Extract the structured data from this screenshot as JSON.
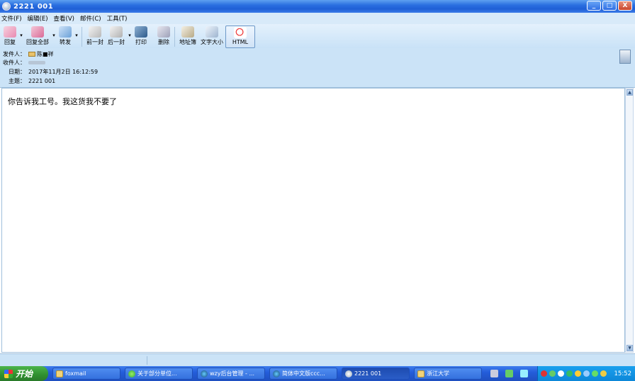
{
  "window": {
    "title": "2221 001",
    "buttons": {
      "minimize": "_",
      "maximize": "□",
      "close": "X"
    }
  },
  "menu": [
    "文件(F)",
    "编辑(E)",
    "查看(V)",
    "邮件(C)",
    "工具(T)"
  ],
  "toolbar": {
    "reply": "回复",
    "reply_all": "回复全部",
    "forward": "转发",
    "prev": "前一封",
    "next": "后一封",
    "print": "打印",
    "delete": "删除",
    "address_book": "地址簿",
    "font_size": "文字大小",
    "html": "HTML"
  },
  "header": {
    "from_label": "发件人：",
    "from_value": "陈■祥",
    "to_label": "收件人：",
    "date_label": "日期：",
    "date_value": "2017年11月2日 16:12:59",
    "subject_label": "主题：",
    "subject_value": "2221 001"
  },
  "body": {
    "text": "你告诉我工号。我这货我不要了"
  },
  "taskbar": {
    "start": "开始",
    "tasks": [
      {
        "label": "foxmail",
        "icon": "folder-icon"
      },
      {
        "label": "关于部分单位...",
        "icon": "green-globe-icon"
      },
      {
        "label": "wzy后台管理 - ...",
        "icon": "ie-icon"
      },
      {
        "label": "简体中文版ccc...",
        "icon": "ie-icon"
      },
      {
        "label": "2221 001",
        "icon": "mail-icon"
      },
      {
        "label": "浙江大学",
        "icon": "folder-icon"
      }
    ],
    "clock": "15:52"
  }
}
